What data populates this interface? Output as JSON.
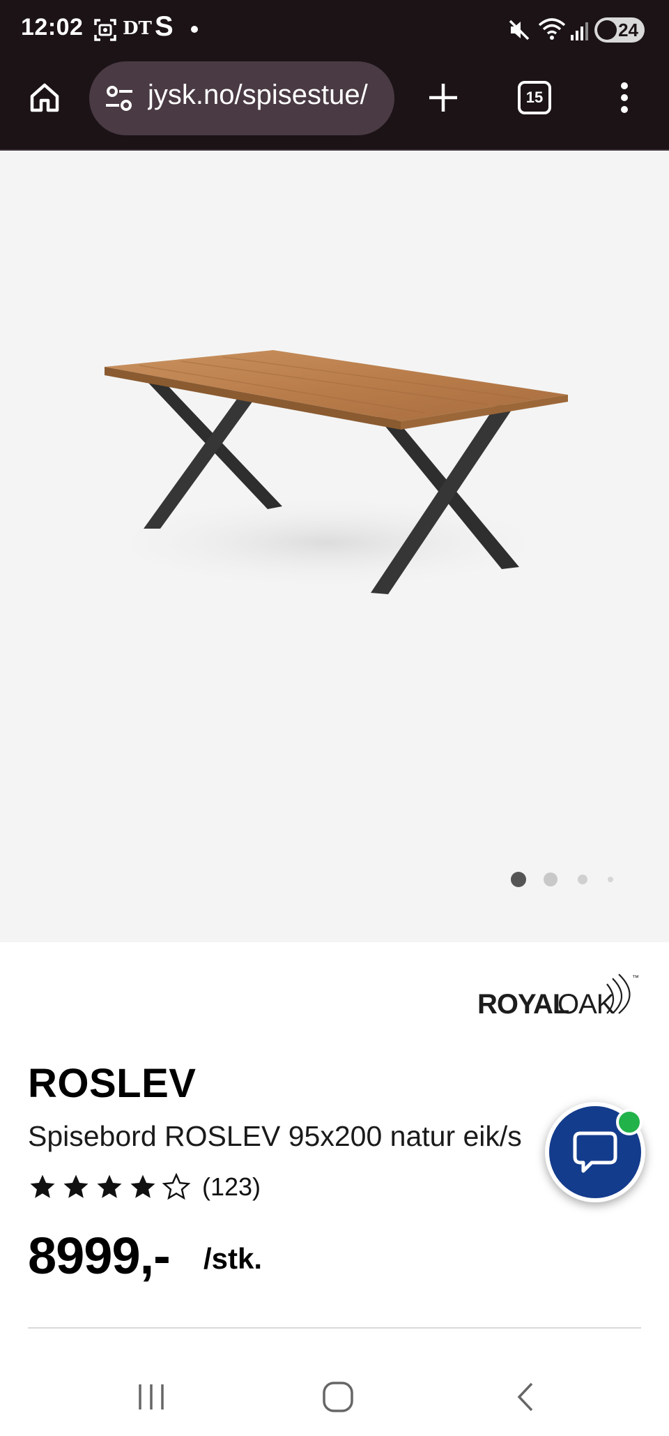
{
  "status_bar": {
    "time": "12:02",
    "notification_icons": [
      "screenshot-icon",
      "newspaper-dt-icon",
      "s-app-icon"
    ],
    "dt_label": "DT",
    "s_label": "S",
    "right_icons": [
      "mute-icon",
      "wifi-icon",
      "signal-icon"
    ],
    "battery": "24"
  },
  "browser": {
    "url": "jysk.no/spisestue/",
    "tab_count": "15",
    "icons": [
      "home-icon",
      "site-settings-icon",
      "new-tab-icon",
      "tab-switcher-icon",
      "more-menu-icon"
    ]
  },
  "gallery": {
    "slide_count": 4,
    "active_slide": 1
  },
  "product": {
    "brand": "ROYALOAK",
    "brand_part1": "ROYAL",
    "brand_part2": "OAK",
    "brand_tm": "™",
    "name": "ROSLEV",
    "description": "Spisebord ROSLEV 95x200 natur eik/s",
    "rating": 4,
    "rating_max": 5,
    "review_count": "(123)",
    "price": "8999,-",
    "unit": "/stk."
  },
  "chat": {
    "status_color": "#21b24a",
    "button_color": "#143c8c"
  },
  "nav": {
    "icons": [
      "recent-apps-icon",
      "home-nav-icon",
      "back-icon"
    ]
  }
}
